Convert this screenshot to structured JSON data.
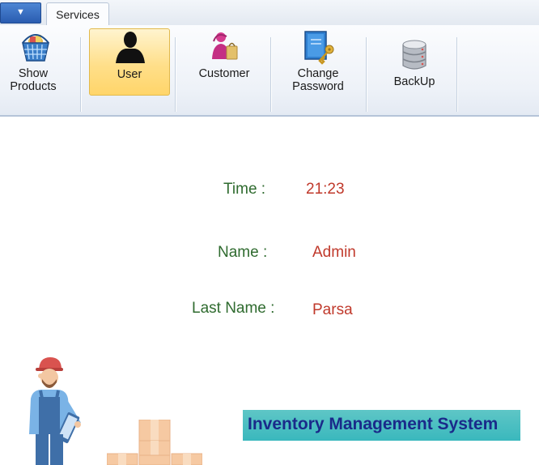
{
  "window": {
    "app_menu_glyph": "▼",
    "tabs": [
      {
        "label": "Services",
        "active": true
      }
    ]
  },
  "ribbon": {
    "buttons": [
      {
        "id": "show-products",
        "label_line1": "Show",
        "label_line2": "Products",
        "icon": "basket-icon"
      },
      {
        "id": "user",
        "label": "User",
        "icon": "user-silhouette-icon",
        "selected": true
      },
      {
        "id": "customer",
        "label": "Customer",
        "icon": "customer-icon"
      },
      {
        "id": "change-password",
        "label_line1": "Change",
        "label_line2": "Password",
        "icon": "book-key-icon"
      },
      {
        "id": "backup",
        "label": "BackUp",
        "icon": "database-icon"
      }
    ]
  },
  "info": {
    "time_label": "Time :",
    "time_value": "21:23",
    "name_label": "Name :",
    "name_value": "Admin",
    "last_name_label": "Last Name :",
    "last_name_value": "Parsa"
  },
  "banner": {
    "title": "Inventory Management System"
  },
  "colors": {
    "label_green": "#2f6b2f",
    "value_red": "#c0392b",
    "banner_bg": "#3ab8bd",
    "banner_text": "#1a2a8a",
    "selected_button": "#ffd56a"
  }
}
